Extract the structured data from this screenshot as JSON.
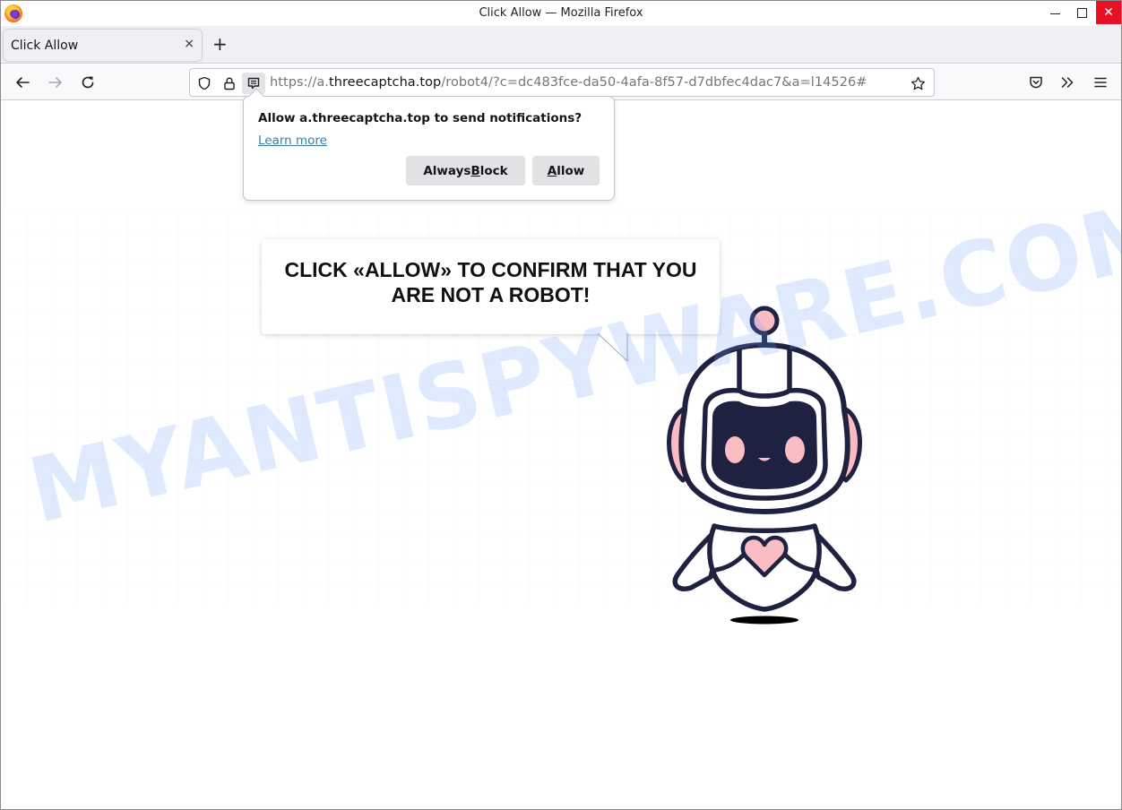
{
  "window": {
    "title": "Click Allow — Mozilla Firefox",
    "controls": {
      "minimize": "minimize",
      "maximize": "maximize",
      "close": "✕"
    }
  },
  "tabs": [
    {
      "label": "Click Allow",
      "active": true,
      "close_glyph": "×"
    }
  ],
  "new_tab_glyph": "+",
  "navbar": {
    "url_scheme_prefix": "https://a.",
    "url_host": "threecaptcha.top",
    "url_path": "/robot4/?c=dc483fce-da50-4afa-8f57-d7dbfec4dac7&a=l14526#",
    "icons": [
      "back-arrow-icon",
      "forward-arrow-icon",
      "reload-icon",
      "shield-icon",
      "lock-icon",
      "notification-permission-icon",
      "bookmark-star-icon",
      "pocket-icon",
      "overflow-chevrons-icon",
      "hamburger-menu-icon"
    ]
  },
  "notification_prompt": {
    "message": "Allow a.threecaptcha.top to send notifications?",
    "learn_more": "Learn more",
    "block_button": {
      "pre": "Always ",
      "accel": "B",
      "post": "lock"
    },
    "allow_button": {
      "pre": "",
      "accel": "A",
      "post": "llow"
    }
  },
  "page": {
    "headline": "CLICK «ALLOW» TO CONFIRM THAT YOU ARE NOT A ROBOT!",
    "watermark": "MYANTISPYWARE.COM",
    "robot_colors": {
      "outline": "#1e2240",
      "visor": "#1e2240",
      "accent": "#f8bcc2",
      "body": "#ffffff"
    }
  }
}
